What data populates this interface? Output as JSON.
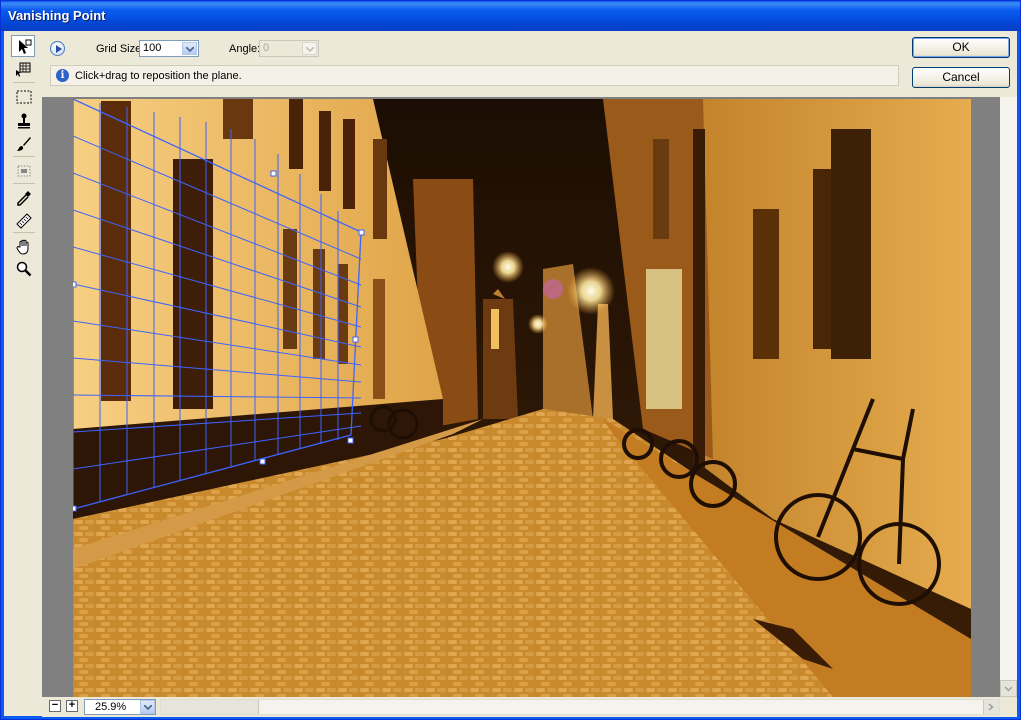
{
  "window": {
    "title": "Vanishing Point"
  },
  "toolbar": {
    "tools": [
      {
        "icon": "edit-plane-icon",
        "active": true
      },
      {
        "icon": "create-plane-icon",
        "active": false
      },
      {
        "icon": "marquee-icon",
        "active": false
      },
      {
        "icon": "stamp-icon",
        "active": false
      },
      {
        "icon": "brush-icon",
        "active": false
      },
      {
        "icon": "transform-icon",
        "active": false
      },
      {
        "icon": "eyedropper-icon",
        "active": false
      },
      {
        "icon": "measure-icon",
        "active": false
      },
      {
        "icon": "hand-icon",
        "active": false
      },
      {
        "icon": "zoom-icon",
        "active": false
      }
    ]
  },
  "options": {
    "grid_size_label": "Grid Size:",
    "grid_size_value": "100",
    "angle_label": "Angle:",
    "angle_value": "0"
  },
  "info": {
    "text": "Click+drag to reposition the plane."
  },
  "buttons": {
    "ok_label": "OK",
    "cancel_label": "Cancel"
  },
  "status": {
    "zoom_value": "25.9%",
    "zoom_out": "−",
    "zoom_in": "+"
  },
  "colors": {
    "grid_line": "#3c64ff",
    "accent": "#0a5bf1"
  }
}
